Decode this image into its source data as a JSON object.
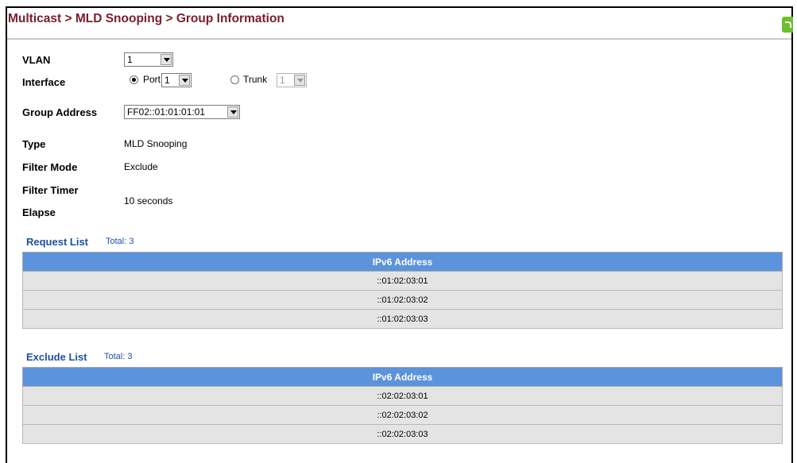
{
  "header": {
    "breadcrumb": "Multicast > MLD Snooping > Group Information"
  },
  "form": {
    "vlan": {
      "label": "VLAN",
      "value": "1"
    },
    "interface": {
      "label": "Interface",
      "port_label": "Port",
      "port_value": "1",
      "port_selected": true,
      "trunk_label": "Trunk",
      "trunk_value": "1"
    },
    "group_address": {
      "label": "Group Address",
      "value": "FF02::01:01:01:01"
    },
    "type": {
      "label": "Type",
      "value": "MLD Snooping"
    },
    "filter_mode": {
      "label": "Filter Mode",
      "value": "Exclude"
    },
    "filter_timer": {
      "label_line1": "Filter Timer",
      "label_line2": "Elapse",
      "value": "10 seconds"
    }
  },
  "request_list": {
    "title": "Request List",
    "total": "Total: 3",
    "column": "IPv6 Address",
    "rows": [
      "::01:02:03:01",
      "::01:02:03:02",
      "::01:02:03:03"
    ]
  },
  "exclude_list": {
    "title": "Exclude List",
    "total": "Total: 3",
    "column": "IPv6 Address",
    "rows": [
      "::02:02:03:01",
      "::02:02:03:02",
      "::02:02:03:03"
    ]
  },
  "colors": {
    "breadcrumb": "#7b1d2b",
    "section_title": "#1f4fa3",
    "table_header": "#5b93dc",
    "table_row": "#e4e4e4"
  }
}
